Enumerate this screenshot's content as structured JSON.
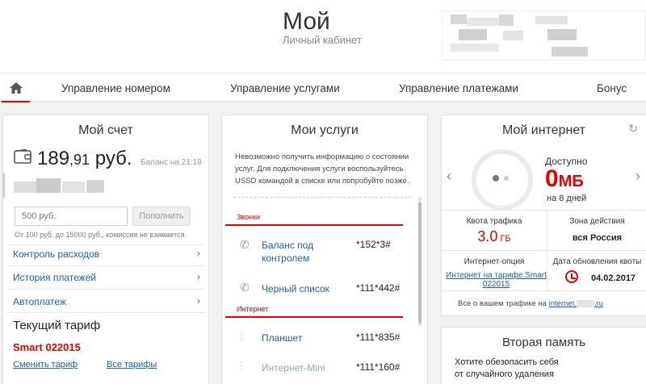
{
  "header": {
    "title": "Мой",
    "subtitle": "Личный кабинет"
  },
  "nav": {
    "home_icon": "home-icon",
    "items": [
      {
        "label": "Управление номером"
      },
      {
        "label": "Управление услугами"
      },
      {
        "label": "Управление платежами"
      },
      {
        "label": "Бонус"
      }
    ]
  },
  "account": {
    "title": "Мой счет",
    "wallet_icon": "wallet-icon",
    "balance_main": "189",
    "balance_cents": ",91",
    "balance_currency": " руб.",
    "balance_date": "Баланс на 21:18",
    "amount_placeholder": "500 руб.",
    "topup_label": "Пополнить",
    "topup_note": "От 100 руб. до 15000 руб., комиссия не взимается",
    "links": [
      {
        "label": "Контроль расходов"
      },
      {
        "label": "История платежей"
      },
      {
        "label": "Автоплатеж"
      }
    ],
    "tariff_heading": "Текущий тариф",
    "tariff_name": "Smart 022015",
    "change_tariff": "Сменить тариф",
    "all_tariffs": "Все тарифы"
  },
  "services": {
    "title": "Мои услуги",
    "message": "Невозможно получить информацию о состоянии услуг. Для подключения услуги воспользуйтесь USSD командой в списке или попробуйте позже.",
    "sections": [
      {
        "name": "Звонки",
        "items": [
          {
            "name": "Баланс под контролем",
            "code": "*152*3#",
            "icon": "phone-icon"
          },
          {
            "name": "Черный список",
            "code": "*111*442#",
            "icon": "phone-icon"
          }
        ]
      },
      {
        "name": "Интернет",
        "items": [
          {
            "name": "Планшет",
            "code": "*111*835#",
            "icon": "wifi-icon"
          },
          {
            "name": "Интернет-Mini",
            "code": "*111*160#",
            "icon": "wifi-icon"
          }
        ]
      }
    ]
  },
  "internet": {
    "title": "Мой интернет",
    "available_label": "Доступно",
    "available_value": "0",
    "available_unit": "МБ",
    "available_days": "на 8 дней",
    "quota_label": "Квота трафика",
    "quota_value": "3.0",
    "quota_unit": " ГБ",
    "zone_label": "Зона действия",
    "zone_value": "вся Россия",
    "option_label": "Интернет-опция",
    "option_link": "Интернет на тарифе Smart 022015",
    "quota_date_label": "Дата обновления квоты",
    "quota_date": "04.02.2017",
    "traffic_text": "Все о вашем трафике на",
    "traffic_link_a": "internet.",
    "traffic_link_b": ".ru"
  },
  "memory": {
    "title": "Вторая память",
    "text": "Хотите обезопасить себя от случайного удаления"
  }
}
